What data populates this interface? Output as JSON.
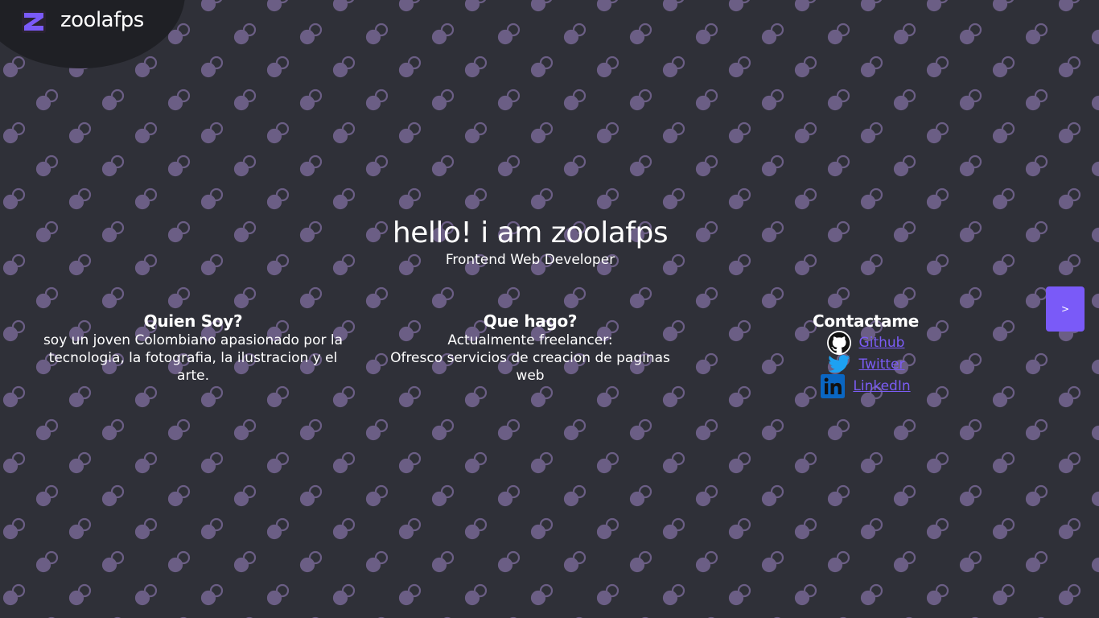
{
  "brand": {
    "logo_letter": "Z",
    "name": "zoolafps"
  },
  "hero": {
    "title": "hello! i am zoolafps",
    "subtitle": "Frontend Web Developer"
  },
  "sections": {
    "who": {
      "heading": "Quien Soy?",
      "text": "soy un joven Colombiano apasionado por la tecnologia, la fotografia, la ilustracion y el arte."
    },
    "what": {
      "heading": "Que hago?",
      "line1": "Actualmente freelancer:",
      "line2": "Ofresco servicios de creacion de paginas web"
    },
    "contact": {
      "heading": "Contactame",
      "links": [
        {
          "label": "Github",
          "icon": "github-icon"
        },
        {
          "label": "Twitter",
          "icon": "twitter-icon"
        },
        {
          "label": "LinkedIn",
          "icon": "linkedin-icon"
        }
      ]
    }
  },
  "next_button": {
    "label": ">"
  },
  "colors": {
    "background": "#2f3038",
    "pattern": "#6b5e85",
    "accent": "#7a5af8",
    "link": "#7b5cf5",
    "twitter": "#1da1f2",
    "linkedin": "#0a66c2"
  }
}
